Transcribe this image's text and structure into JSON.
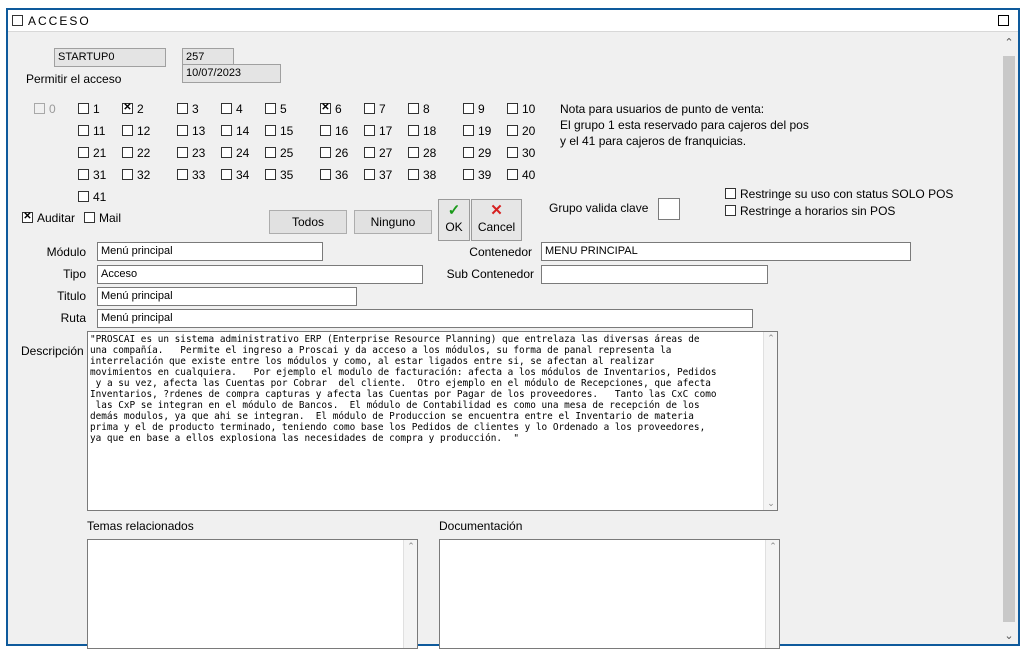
{
  "window": {
    "title": "ACCESO"
  },
  "header": {
    "code": "STARTUP0",
    "number": "257",
    "date": "10/07/2023",
    "permit_label": "Permitir el acceso"
  },
  "groups": {
    "row1": [
      {
        "label": "0",
        "checked": false,
        "disabled": true
      },
      {
        "label": "1",
        "checked": false
      },
      {
        "label": "2",
        "checked": true
      },
      {
        "label": "3",
        "checked": false
      },
      {
        "label": "4",
        "checked": false
      },
      {
        "label": "5",
        "checked": false
      },
      {
        "label": "6",
        "checked": true
      },
      {
        "label": "7",
        "checked": false
      },
      {
        "label": "8",
        "checked": false
      },
      {
        "label": "9",
        "checked": false
      },
      {
        "label": "10",
        "checked": false
      }
    ],
    "row2": [
      "11",
      "12",
      "13",
      "14",
      "15",
      "16",
      "17",
      "18",
      "19",
      "20"
    ],
    "row3": [
      "21",
      "22",
      "23",
      "24",
      "25",
      "26",
      "27",
      "28",
      "29",
      "30"
    ],
    "row4": [
      "31",
      "32",
      "33",
      "34",
      "35",
      "36",
      "37",
      "38",
      "39",
      "40"
    ],
    "row5": [
      "41"
    ]
  },
  "note": {
    "line1": "Nota para usuarios de punto de venta:",
    "line2": "El grupo 1 esta reservado para cajeros del pos",
    "line3": "y el 41 para cajeros de franquicias."
  },
  "options": {
    "auditar_label": "Auditar",
    "auditar_checked": true,
    "mail_label": "Mail",
    "mail_checked": false,
    "todos_label": "Todos",
    "ninguno_label": "Ninguno",
    "ok_label": "OK",
    "cancel_label": "Cancel",
    "grupo_valida_label": "Grupo valida clave",
    "grupo_valida_value": "",
    "restringe_pos_label": "Restringe su uso con status  SOLO POS",
    "restringe_horarios_label": "Restringe a horarios sin POS"
  },
  "form": {
    "modulo_label": "Módulo",
    "modulo_value": "Menú principal",
    "tipo_label": "Tipo",
    "tipo_value": "Acceso",
    "titulo_label": "Titulo",
    "titulo_value": "Menú principal",
    "ruta_label": "Ruta",
    "ruta_value": "Menú principal",
    "contenedor_label": "Contenedor",
    "contenedor_value": "MENU PRINCIPAL",
    "subcontenedor_label": "Sub Contenedor",
    "subcontenedor_value": "",
    "descripcion_label": "Descripción",
    "descripcion_lines": [
      "\"PROSCAI es un sistema administrativo ERP (Enterprise Resource Planning) que entrelaza las diversas áreas de",
      "una compañía.   Permite el ingreso a Proscai y da acceso a los módulos, su forma de panal representa la",
      "interrelación que existe entre los módulos y como, al estar ligados entre si, se afectan al realizar",
      "movimientos en cualquiera.   Por ejemplo el modulo de facturación: afecta a los módulos de Inventarios, Pedidos",
      " y a su vez, afecta las Cuentas por Cobrar  del cliente.  Otro ejemplo en el módulo de Recepciones, que afecta",
      "Inventarios, ?rdenes de compra capturas y afecta las Cuentas por Pagar de los proveedores.   Tanto las CxC como",
      " las CxP se integran en el módulo de Bancos.  El módulo de Contabilidad es como una mesa de recepción de los",
      "demás modulos, ya que ahi se integran.  El módulo de Produccion se encuentra entre el Inventario de materia",
      "prima y el de producto terminado, teniendo como base los Pedidos de clientes y lo Ordenado a los proveedores,",
      "ya que en base a ellos explosiona las necesidades de compra y producción.  \""
    ],
    "temas_label": "Temas relacionados",
    "documentacion_label": "Documentación"
  }
}
